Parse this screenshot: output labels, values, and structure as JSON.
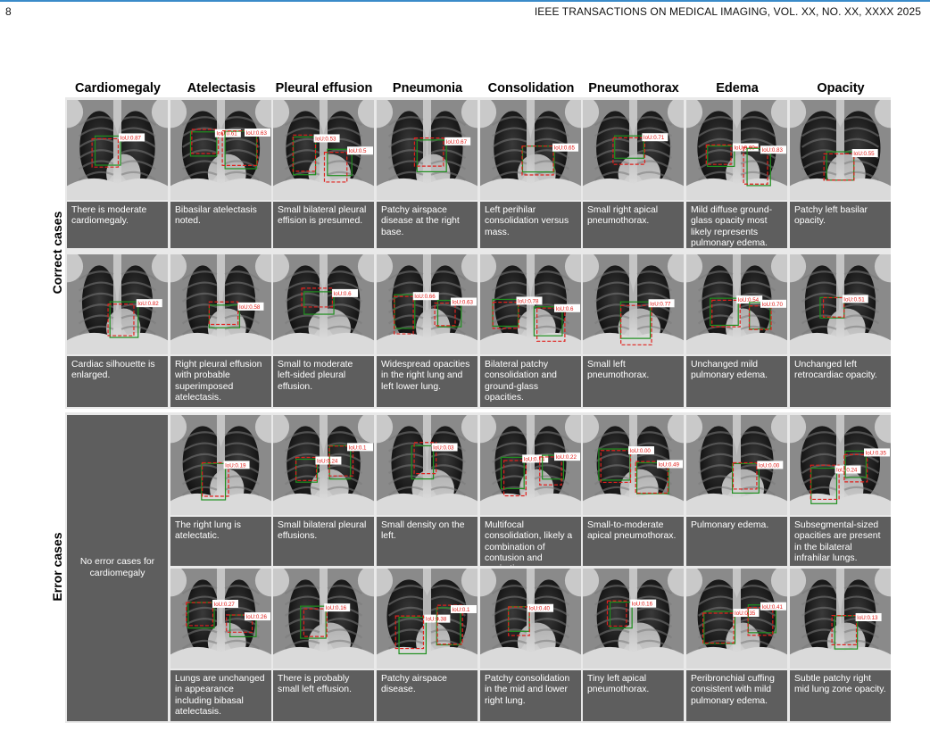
{
  "header": {
    "page_number": "8",
    "journal": "IEEE TRANSACTIONS ON MEDICAL IMAGING, VOL. XX, NO. XX, XXXX 2025"
  },
  "columns": [
    "Cardiomegaly",
    "Atelectasis",
    "Pleural effusion",
    "Pneumonia",
    "Consolidation",
    "Pneumothorax",
    "Edema",
    "Opacity"
  ],
  "row_labels": {
    "correct": "Correct cases",
    "error": "Error cases"
  },
  "colors": {
    "gt_box": "#1f8f1f",
    "pred_box": "#e0201c",
    "caption_bg": "#5e5e5e",
    "section_bg": "#e9e9e9"
  },
  "correct": [
    {
      "captions": [
        "There is moderate cardiomegaly.",
        "Bibasilar atelectasis noted.",
        "Small bilateral pleural effision is presumed.",
        "Patchy airspace disease at the right base.",
        "Left perihilar consolidation versus mass.",
        "Small right apical pneumothorax.",
        "Mild diffuse ground-glass opacity most likely represents pulmonary edema.",
        "Patchy left basilar opacity."
      ],
      "iou": [
        [
          "IoU:0.87"
        ],
        [
          "IoU:0.61",
          "IoU:0.63"
        ],
        [
          "IoU:0.53",
          "IoU:0.5"
        ],
        [
          "IoU:0.67"
        ],
        [
          "IoU:0.65"
        ],
        [
          "IoU:0.71"
        ],
        [
          "IoU:0.69",
          "IoU:0.83"
        ],
        [
          "IoU:0.55"
        ]
      ]
    },
    {
      "captions": [
        "Cardiac silhouette is enlarged.",
        "Right pleural effusion with probable superimposed atelectasis.",
        "Small to moderate left-sided pleural effusion.",
        "Widespread opacities in the right lung and left lower lung.",
        "Bilateral patchy consolidation and ground-glass opacities.",
        "Small left pneumothorax.",
        "Unchanged mild pulmonary edema.",
        "Unchanged left retrocardiac opacity."
      ],
      "iou": [
        [
          "IoU:0.82"
        ],
        [
          "IoU:0.58"
        ],
        [
          "IoU:0.6"
        ],
        [
          "IoU:0.66",
          "IoU:0.63"
        ],
        [
          "IoU:0.78",
          "IoU:0.6"
        ],
        [
          "IoU:0.77"
        ],
        [
          "IoU:0.54",
          "IoU:0.70"
        ],
        [
          "IoU:0.51"
        ]
      ]
    }
  ],
  "error": {
    "no_error_text": "No error cases for cardiomegaly",
    "rows": [
      {
        "captions": [
          "The right lung is atelectatic.",
          "Small bilateral pleural effusions.",
          "Small density on the left.",
          "Multifocal consolidation, likely a combination of contusion and aspiration.",
          "Small-to-moderate apical pneumothorax.",
          "Pulmonary edema.",
          "Subsegmental-sized opacities are present in the bilateral infrahilar lungs."
        ],
        "iou": [
          [
            "IoU:0.19"
          ],
          [
            "IoU:0.24",
            "IoU:0.1"
          ],
          [
            "IoU:0.03"
          ],
          [
            "IoU:0.14",
            "IoU:0.22"
          ],
          [
            "IoU:0.00",
            "IoU:0.49"
          ],
          [
            "IoU:0.00"
          ],
          [
            "IoU:0.24",
            "IoU:0.35"
          ]
        ]
      },
      {
        "captions": [
          "Lungs are unchanged in appearance including bibasal atelectasis.",
          "There is probably small left effusion.",
          "Patchy airspace disease.",
          "Patchy consolidation in the mid and lower right lung.",
          "Tiny left apical pneumothorax.",
          "Peribronchial cuffing consistent with mild pulmonary edema.",
          "Subtle patchy right mid lung zone opacity."
        ],
        "iou": [
          [
            "IoU:0.27",
            "IoU:0.26"
          ],
          [
            "IoU:0.16"
          ],
          [
            "IoU:0.38",
            "IoU:0.1"
          ],
          [
            "IoU:0.40"
          ],
          [
            "IoU:0.16"
          ],
          [
            "IoU:0.35",
            "IoU:0.41"
          ],
          [
            "IoU:0.13"
          ]
        ]
      }
    ]
  }
}
